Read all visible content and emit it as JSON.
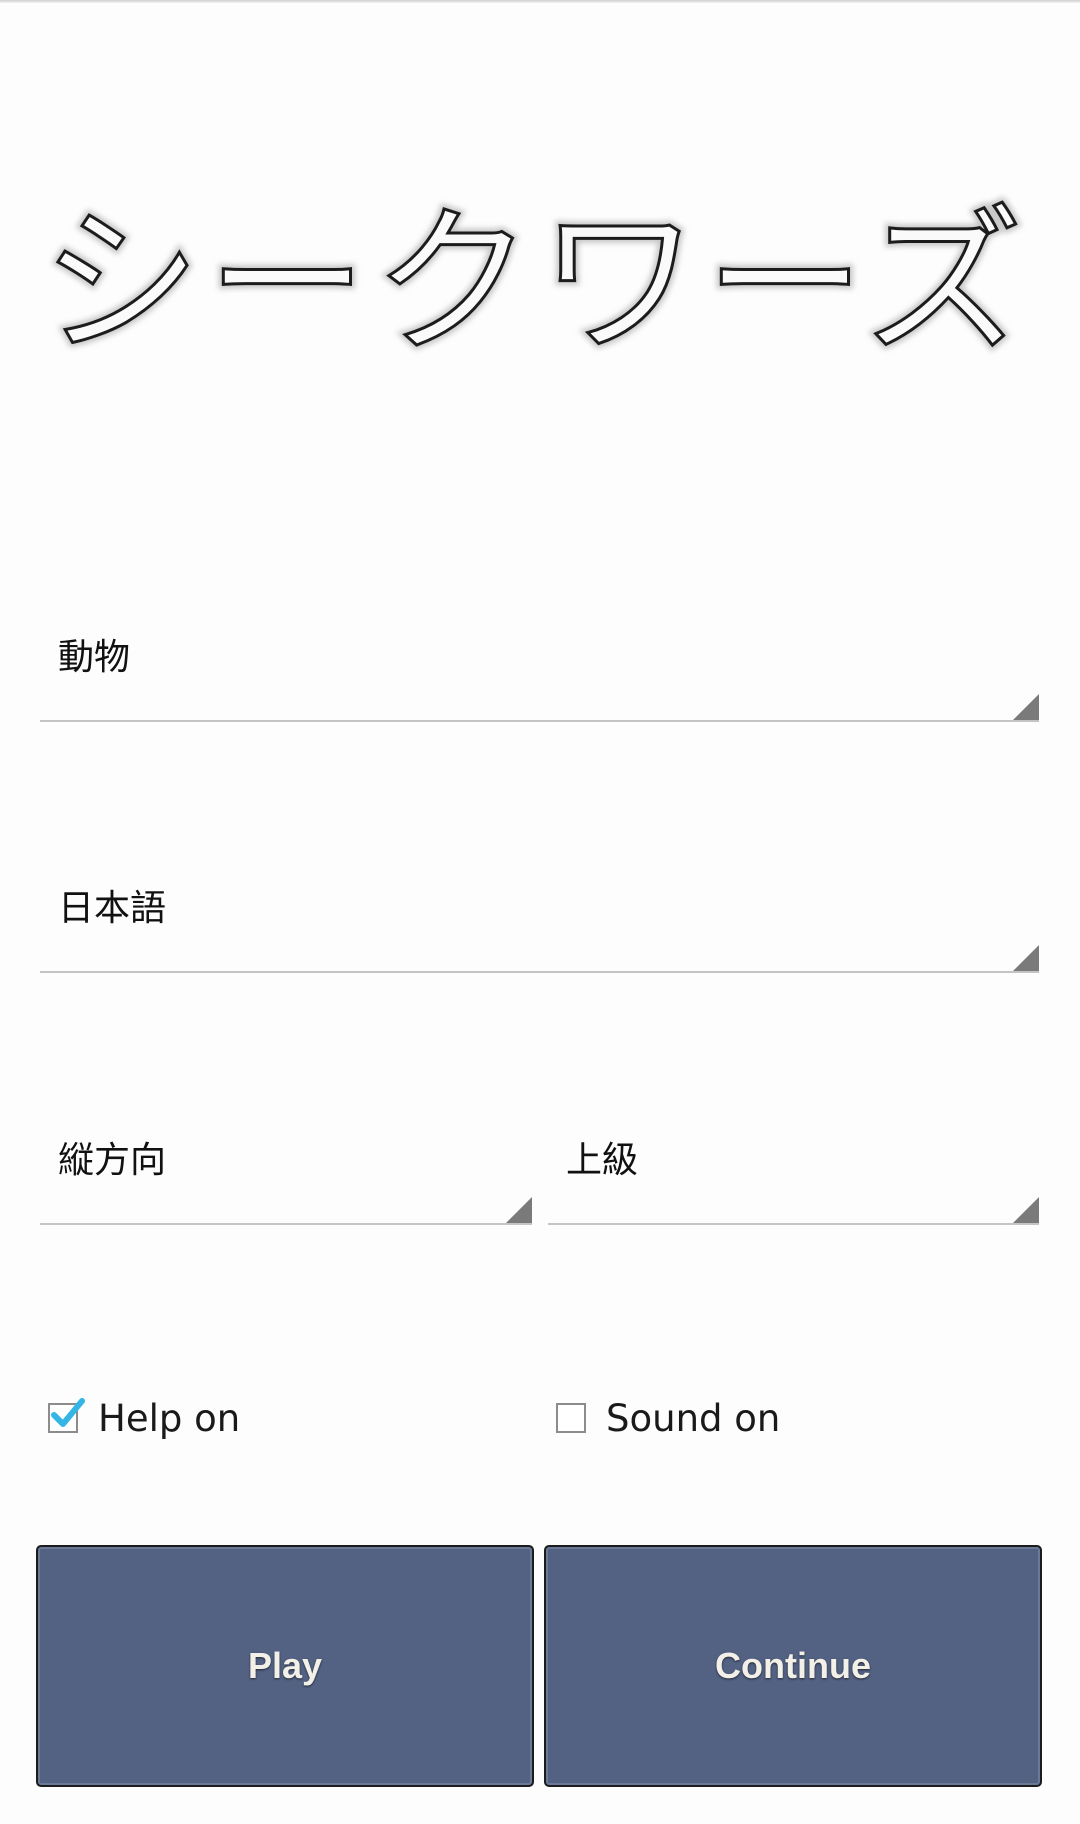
{
  "logo": {
    "text": "シークワーズ"
  },
  "spinners": {
    "category": "動物",
    "language": "日本語",
    "direction": "縦方向",
    "level": "上級"
  },
  "options": {
    "help": {
      "label": "Help on",
      "checked": true
    },
    "sound": {
      "label": "Sound on",
      "checked": false
    }
  },
  "buttons": {
    "play": "Play",
    "continue": "Continue"
  },
  "colors": {
    "button_bg": "#536183",
    "check_accent": "#33b5e5"
  }
}
